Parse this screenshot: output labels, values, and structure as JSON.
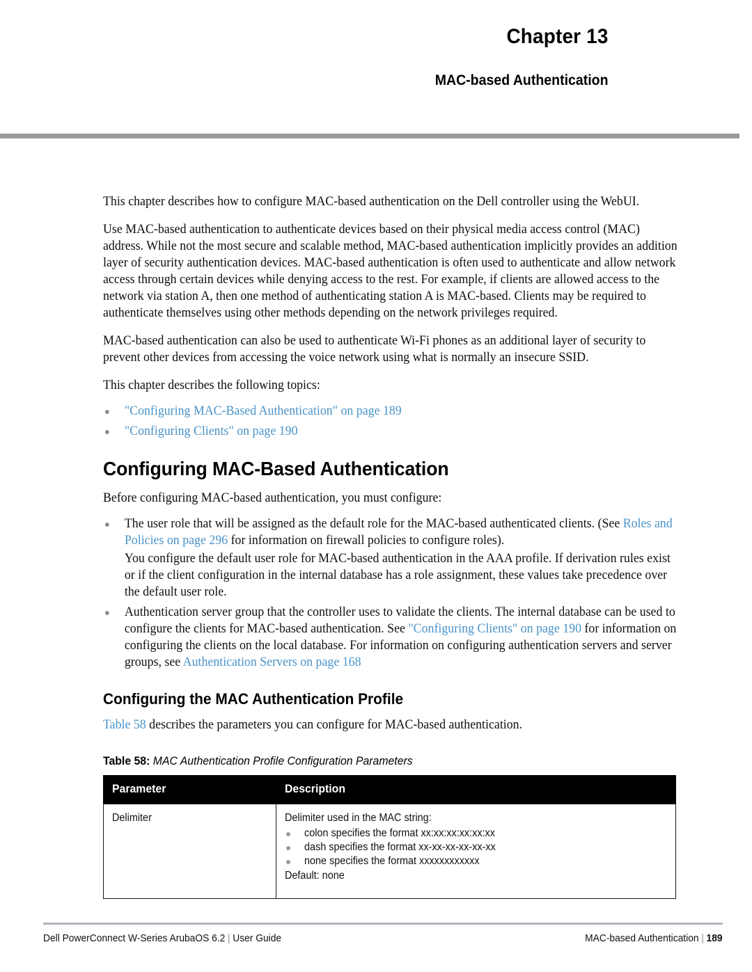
{
  "header": {
    "chapter_label": "Chapter  13",
    "chapter_subtitle": "MAC-based Authentication"
  },
  "body": {
    "intro_paragraph": "This chapter describes how to configure MAC-based authentication on the Dell  controller using the WebUI.",
    "paragraph_2": "Use MAC-based authentication to authenticate devices based on their physical media access control (MAC) address. While not the most secure and scalable method, MAC-based authentication implicitly provides an addition layer of security authentication devices. MAC-based authentication is often used to authenticate and allow network access through certain devices while denying access to the rest. For example, if clients are allowed access to the network via station A, then one method of authenticating station A is MAC-based. Clients may be required to authenticate themselves using other methods depending on the network privileges required.",
    "paragraph_3": "MAC-based authentication can also be used to authenticate Wi-Fi phones as an additional layer of security to prevent other devices from accessing the voice network using what is normally an insecure SSID.",
    "topics_lead": "This chapter describes the following topics:",
    "topics": [
      "\"Configuring MAC-Based Authentication\" on page 189",
      "\"Configuring Clients\" on page 190"
    ]
  },
  "section": {
    "heading": "Configuring MAC-Based Authentication",
    "lead": "Before configuring MAC-based authentication, you must configure:",
    "bullet_1": {
      "pre": "The user role that will be assigned as the default role for the MAC-based authenticated clients. (See ",
      "link": "Roles and Policies on page 296",
      "post": " for information on firewall policies to configure roles)."
    },
    "bullet_1_continuation": "You configure the default user role for MAC-based authentication in the AAA profile. If derivation rules exist or if the client configuration in the internal database has a role assignment, these values take precedence over the default user role.",
    "bullet_2": {
      "pre": "Authentication server group that the controller uses to validate the clients. The internal database can be used to configure the clients for MAC-based authentication. See ",
      "link_1": "\"Configuring Clients\" on page 190",
      "mid": " for information on configuring the clients on the local database. For information on configuring authentication servers and server groups, see ",
      "link_2": "Authentication Servers on page 168"
    }
  },
  "subsection": {
    "heading": "Configuring the MAC Authentication Profile",
    "lead_link": "Table 58",
    "lead_rest": " describes the parameters you can configure for MAC-based authentication."
  },
  "table": {
    "caption_label": "Table 58",
    "caption_separator": ": ",
    "caption_title": "MAC Authentication Profile Configuration Parameters",
    "columns": [
      "Parameter",
      "Description"
    ],
    "rows": [
      {
        "parameter": "Delimiter",
        "description_lead": "Delimiter used in the MAC string:",
        "description_bullets": [
          "colon specifies the format xx:xx:xx:xx:xx:xx",
          "dash specifies the format xx-xx-xx-xx-xx-xx",
          "none specifies the format xxxxxxxxxxxx"
        ],
        "description_default": "Default: none"
      }
    ]
  },
  "footer": {
    "left_text": "Dell PowerConnect W-Series ArubaOS 6.2",
    "left_separator": "|",
    "left_doc": "User Guide",
    "right_text": "MAC-based Authentication",
    "right_separator": "|",
    "page_number": "189"
  },
  "colors": {
    "link_blue": "#4a93c9",
    "rule_gray": "#9a9a9d",
    "footer_rule": "#b4b3bd",
    "bullet_gray": "#8c8c8c",
    "table_header_bg": "#000000"
  }
}
